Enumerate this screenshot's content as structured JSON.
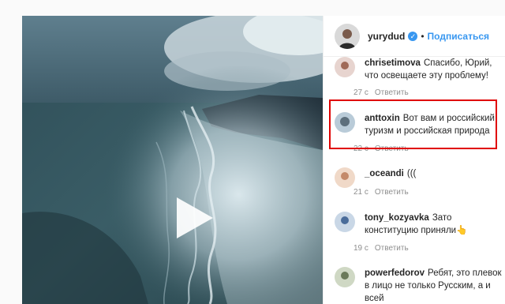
{
  "post": {
    "username": "yurydud",
    "follow_label": "Подписаться",
    "dot": "•"
  },
  "comments": [
    {
      "user": "chrisetimova",
      "text": "Спасибо, Юрий, что освещаете эту проблему!",
      "time": "27 с",
      "reply": "Ответить"
    },
    {
      "user": "anttoxin",
      "text": "Вот вам и российский туризм и российская природа",
      "time": "22 с",
      "reply": "Ответить"
    },
    {
      "user": "_oceandi",
      "text": "(((",
      "time": "21 с",
      "reply": "Ответить"
    },
    {
      "user": "tony_kozyavka",
      "text": "Зато конституцию приняли👆",
      "time": "19 с",
      "reply": "Ответить"
    },
    {
      "user": "powerfedorov",
      "text": "Ребят, это плевок в лицо не только Русским, а и всей",
      "time": "",
      "reply": ""
    }
  ],
  "icons": {
    "verified": "verified-badge-icon",
    "play": "play-icon",
    "next": "chevron-right-icon"
  },
  "colors": {
    "accent": "#3897f0",
    "highlight": "#e00000",
    "muted": "#8e8e8e"
  }
}
